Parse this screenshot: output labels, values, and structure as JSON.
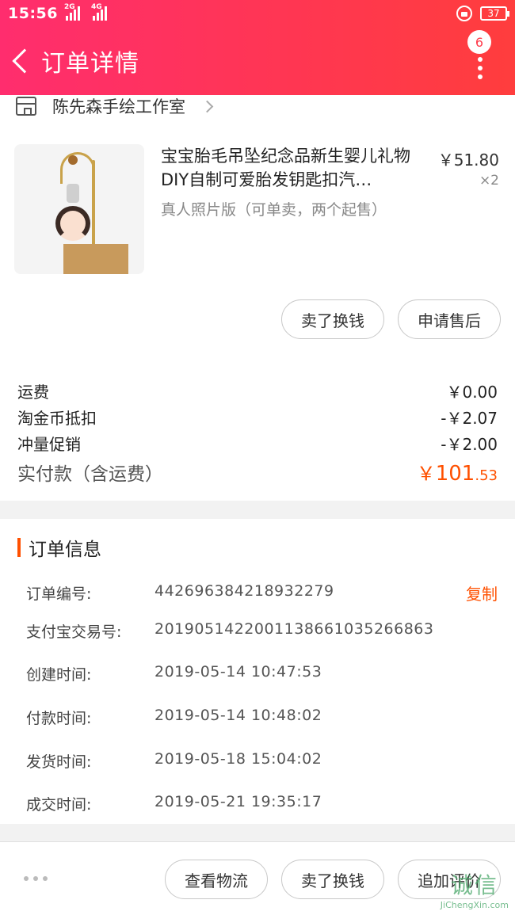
{
  "status_bar": {
    "time": "15:56",
    "net1": "2G",
    "net2": "4G",
    "battery": "37"
  },
  "header": {
    "title": "订单详情",
    "badge": "6"
  },
  "shop": {
    "name": "陈先森手绘工作室"
  },
  "product": {
    "title": "宝宝胎毛吊坠纪念品新生婴儿礼物DIY自制可爱胎发钥匙扣汽…",
    "spec": "真人照片版（可单卖，两个起售）",
    "price": "￥51.80",
    "qty": "×2"
  },
  "item_actions": {
    "sell": "卖了换钱",
    "after_sale": "申请售后"
  },
  "fees": {
    "shipping_label": "运费",
    "shipping_value": "￥0.00",
    "coin_label": "淘金币抵扣",
    "coin_value": "-￥2.07",
    "promo_label": "冲量促销",
    "promo_value": "-￥2.00",
    "total_label": "实付款（含运费）",
    "total_symbol": "￥",
    "total_int": "101",
    "total_cents": ".53"
  },
  "order_info": {
    "title": "订单信息",
    "copy": "复制",
    "rows": [
      {
        "k": "订单编号:",
        "v": "442696384218932279"
      },
      {
        "k": "支付宝交易号:",
        "v": "2019051422001138661035266863"
      },
      {
        "k": "创建时间:",
        "v": "2019-05-14  10:47:53"
      },
      {
        "k": "付款时间:",
        "v": "2019-05-14  10:48:02"
      },
      {
        "k": "发货时间:",
        "v": "2019-05-18  15:04:02"
      },
      {
        "k": "成交时间:",
        "v": "2019-05-21  19:35:17"
      }
    ]
  },
  "bottom_bar": {
    "logistics": "查看物流",
    "sell": "卖了换钱",
    "review": "追加评价"
  },
  "watermark": {
    "cn": "诚信",
    "en": "JiChengXin.com"
  }
}
